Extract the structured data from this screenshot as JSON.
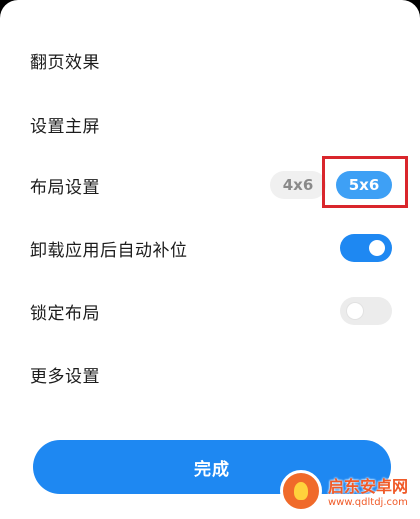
{
  "settings": {
    "rows": [
      {
        "label": "翻页效果"
      },
      {
        "label": "设置主屏"
      },
      {
        "label": "布局设置",
        "options": [
          "4x6",
          "5x6"
        ],
        "selected": "5x6"
      },
      {
        "label": "卸载应用后自动补位",
        "toggle": true
      },
      {
        "label": "锁定布局",
        "toggle": false
      },
      {
        "label": "更多设置"
      }
    ]
  },
  "done_button": {
    "label": "完成"
  },
  "watermark": {
    "title": "启东安卓网",
    "url": "www.qdltdj.com"
  },
  "colors": {
    "accent": "#1e88f2",
    "segment_active": "#3ea0f5",
    "highlight": "#d9262c",
    "watermark": "#f05a28"
  }
}
